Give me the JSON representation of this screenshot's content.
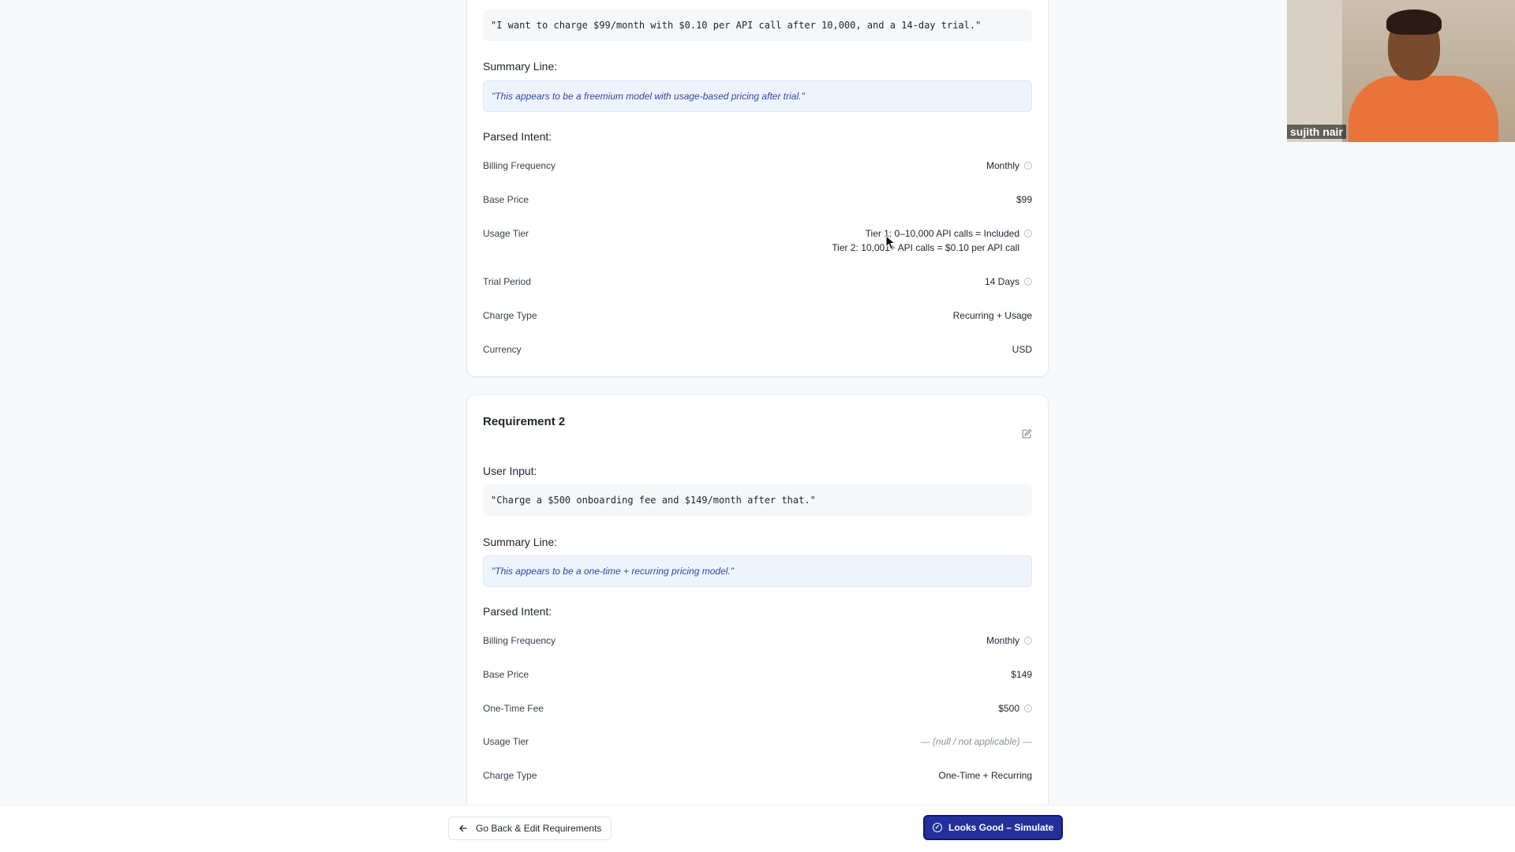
{
  "requirement1": {
    "user_input": "\"I want to charge $99/month with $0.10 per API call after 10,000, and a 14-day trial.\"",
    "summary_label": "Summary Line:",
    "summary": "\"This appears to be a freemium model with usage-based pricing after trial.\"",
    "parsed_label": "Parsed Intent:",
    "fields": {
      "billing_frequency": {
        "label": "Billing Frequency",
        "value": "Monthly"
      },
      "base_price": {
        "label": "Base Price",
        "value": "$99"
      },
      "usage_tier": {
        "label": "Usage Tier",
        "value_line1": "Tier 1: 0–10,000 API calls = Included",
        "value_line2": "Tier 2: 10,001+ API calls = $0.10 per API call"
      },
      "trial_period": {
        "label": "Trial Period",
        "value": "14 Days"
      },
      "charge_type": {
        "label": "Charge Type",
        "value": "Recurring + Usage"
      },
      "currency": {
        "label": "Currency",
        "value": "USD"
      }
    }
  },
  "requirement2": {
    "title": "Requirement 2",
    "user_input_label": "User Input:",
    "user_input": "\"Charge a $500 onboarding fee and $149/month after that.\"",
    "summary_label": "Summary Line:",
    "summary": "\"This appears to be a one-time + recurring pricing model.\"",
    "parsed_label": "Parsed Intent:",
    "fields": {
      "billing_frequency": {
        "label": "Billing Frequency",
        "value": "Monthly"
      },
      "base_price": {
        "label": "Base Price",
        "value": "$149"
      },
      "one_time_fee": {
        "label": "One-Time Fee",
        "value": "$500"
      },
      "usage_tier": {
        "label": "Usage Tier",
        "value": "— (null / not applicable) —"
      },
      "charge_type": {
        "label": "Charge Type",
        "value": "One-Time + Recurring"
      }
    }
  },
  "footer": {
    "back_label": "Go Back & Edit Requirements",
    "primary_label": "Looks Good – Simulate"
  },
  "video": {
    "participant_name": "sujith nair"
  },
  "colors": {
    "primary": "#23309c",
    "summary_bg": "#eef4fd",
    "summary_text": "#2c4aa0"
  }
}
